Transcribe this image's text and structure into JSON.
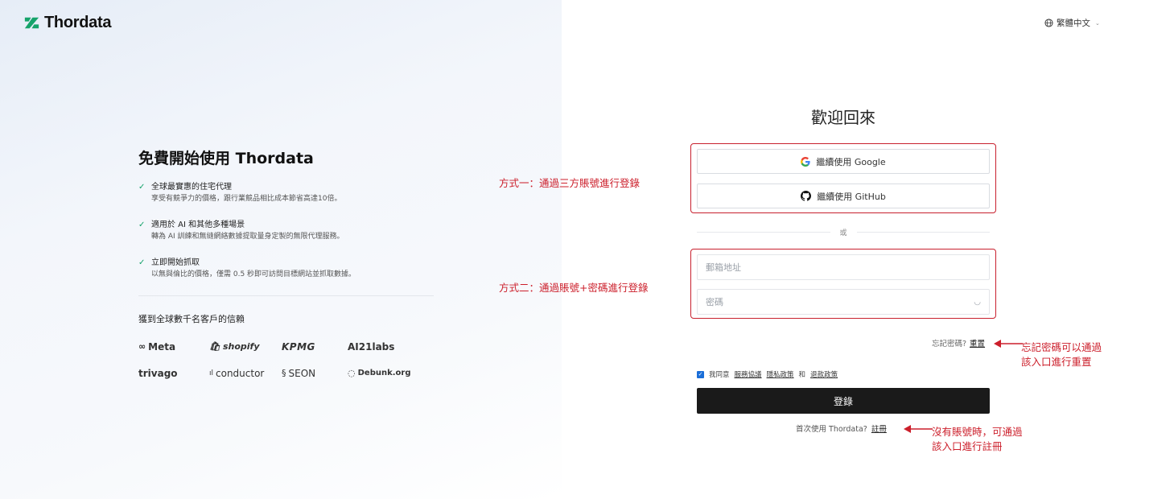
{
  "brand": {
    "name": "Thordata"
  },
  "lang": {
    "label": "繁體中文"
  },
  "promo": {
    "title": "免費開始使用 Thordata",
    "features": [
      {
        "title": "全球最實惠的住宅代理",
        "desc": "享受有競爭力的價格，跟行業競品相比成本節省高達10倍。"
      },
      {
        "title": "適用於 AI 和其他多種場景",
        "desc": "轉為 AI 訓練和無縫網絡數據提取量身定製的無限代理服務。"
      },
      {
        "title": "立即開始抓取",
        "desc": "以無與倫比的價格，僅需 0.5 秒即可訪問目標網站並抓取數據。"
      }
    ],
    "trust_title": "獲到全球數千名客戶的信賴",
    "customers": [
      "Meta",
      "shopify",
      "KPMG",
      "AI21labs",
      "trivago",
      "conductor",
      "SEON",
      "Debunk.org"
    ]
  },
  "login": {
    "title": "歡迎回來",
    "google_label": "繼續使用 Google",
    "github_label": "繼續使用 GitHub",
    "or_label": "或",
    "email_placeholder": "郵箱地址",
    "password_placeholder": "密碼",
    "forgot_text": "忘記密碼?",
    "reset_link": "重置",
    "agree_prefix": "我同意",
    "terms_link": "服務協議",
    "privacy_link": "隱私政策",
    "and_text": "和",
    "refund_link": "退款政策",
    "submit_label": "登錄",
    "signup_prompt": "首次使用 Thordata?",
    "signup_link": "註冊"
  },
  "annotations": {
    "method1": "方式一：通過三方賬號進行登錄",
    "method2": "方式二：通過賬號+密碼進行登錄",
    "reset_line1": "忘記密碼可以通過",
    "reset_line2": "該入口進行重置",
    "signup_line1": "沒有賬號時，可通過",
    "signup_line2": "該入口進行註冊"
  },
  "colors": {
    "accent_green": "#16a36b",
    "annotation_red": "#cc1f2b",
    "button_dark": "#1a1a1a",
    "checkbox_blue": "#1a6ed8"
  }
}
